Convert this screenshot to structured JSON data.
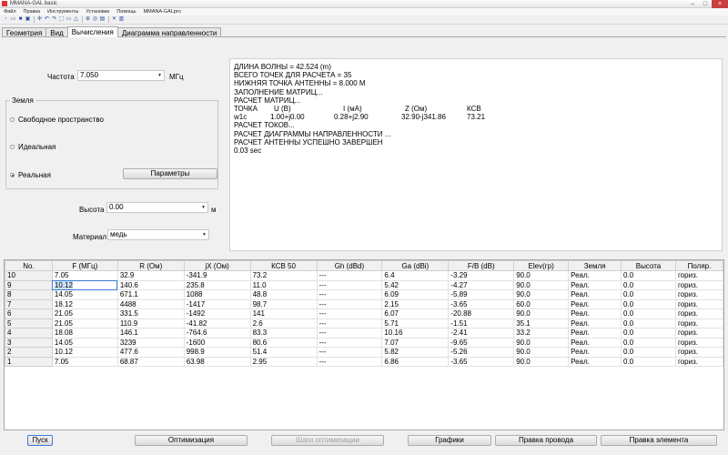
{
  "window": {
    "title": "MMANA-GAL basic"
  },
  "menu": [
    "Файл",
    "Правка",
    "Инструменты",
    "Установки",
    "Помощь",
    "MMANA-GALpro"
  ],
  "toolbar_icons": [
    "new-icon",
    "open-icon",
    "save-icon",
    "print-icon",
    "separator",
    "arrows-icon",
    "undo-icon",
    "redo-icon",
    "select-icon",
    "rect-icon",
    "copy-icon",
    "separator",
    "zoom-icon",
    "target-icon",
    "paste-icon",
    "separator",
    "tools-icon",
    "delete-icon"
  ],
  "tabs": [
    "Геометрия",
    "Вид",
    "Вычисления",
    "Диаграмма направленности"
  ],
  "active_tab": 2,
  "frequency": {
    "label": "Частота",
    "value": "7.050",
    "unit": "МГц"
  },
  "ground": {
    "title": "Земля",
    "options": [
      "Свободное пространство",
      "Идеальная",
      "Реальная"
    ],
    "selected": 2,
    "params_button": "Параметры"
  },
  "height": {
    "label": "Высота",
    "value": "0.00",
    "unit": "м"
  },
  "material": {
    "label": "Материал",
    "value": "медь"
  },
  "log": {
    "lines_top": [
      "ДЛИНА ВОЛНЫ = 42.524 (m)",
      "ВСЕГО ТОЧЕК ДЛЯ РАСЧЕТА = 35",
      "НИЖНЯЯ ТОЧКА АНТЕННЫ = 8.000 М",
      "ЗАПОЛНЕНИЕ МАТРИЦ...",
      "РАСЧЕТ МАТРИЦ..."
    ],
    "table_header": [
      "ТОЧКА",
      "U (В)",
      "I (мА)",
      "Z (Ом)",
      "КСВ"
    ],
    "table_row": [
      "w1c",
      "1.00+j0.00",
      "0.28+j2.90",
      "32.90-j341.86",
      "73.21"
    ],
    "lines_bottom": [
      "РАСЧЕТ ТОКОВ...",
      "РАСЧЕТ ДИАГРАММЫ НАПРАВЛЕННОСТИ ...",
      "РАСЧЕТ АНТЕННЫ УСПЕШНО ЗАВЕРШЕН",
      "0.03 sec"
    ]
  },
  "grid": {
    "columns": [
      "No.",
      "F (МГц)",
      "R (Ом)",
      "jX (Ом)",
      "КСВ 50",
      "Gh (dBd)",
      "Ga (dBi)",
      "F/B (dB)",
      "Elev(гр)",
      "Земля",
      "Высота",
      "Поляр."
    ],
    "rows": [
      [
        "10",
        "7.05",
        "32.9",
        "-341.9",
        "73.2",
        "---",
        "6.4",
        "-3.29",
        "90.0",
        "Реал.",
        "0.0",
        "гориз."
      ],
      [
        "9",
        "10.12",
        "140.6",
        "235.8",
        "11.0",
        "---",
        "5.42",
        "-4.27",
        "90.0",
        "Реал.",
        "0.0",
        "гориз."
      ],
      [
        "8",
        "14.05",
        "671.1",
        "1088",
        "48.8",
        "---",
        "6.09",
        "-5.89",
        "90.0",
        "Реал.",
        "0.0",
        "гориз."
      ],
      [
        "7",
        "18.12",
        "4488",
        "-1417",
        "98.7",
        "---",
        "2.15",
        "-3.65",
        "60.0",
        "Реал.",
        "0.0",
        "гориз."
      ],
      [
        "6",
        "21.05",
        "331.5",
        "-1492",
        "141",
        "---",
        "6.07",
        "-20.88",
        "90.0",
        "Реал.",
        "0.0",
        "гориз."
      ],
      [
        "5",
        "21.05",
        "110.9",
        "-41.82",
        "2.6",
        "---",
        "5.71",
        "-1.51",
        "35.1",
        "Реал.",
        "0.0",
        "гориз."
      ],
      [
        "4",
        "18.08",
        "146.1",
        "-764.6",
        "83.3",
        "---",
        "10.16",
        "-2.41",
        "33.2",
        "Реал.",
        "0.0",
        "гориз."
      ],
      [
        "3",
        "14.05",
        "3239",
        "-1600",
        "80.6",
        "---",
        "7.07",
        "-9.65",
        "90.0",
        "Реал.",
        "0.0",
        "гориз."
      ],
      [
        "2",
        "10.12",
        "477.6",
        "998.9",
        "51.4",
        "---",
        "5.82",
        "-5.26",
        "90.0",
        "Реал.",
        "0.0",
        "гориз."
      ],
      [
        "1",
        "7.05",
        "68.87",
        "63.98",
        "2.95",
        "---",
        "6.86",
        "-3.65",
        "90.0",
        "Реал.",
        "0.0",
        "гориз."
      ]
    ],
    "selected_row": 1,
    "selected_col": 1
  },
  "buttons": {
    "start": "Пуск",
    "optimize": "Оптимизация",
    "opt_steps": "Шаги оптимизации",
    "graphs": "Графики",
    "edit_wire": "Правка провода",
    "edit_element": "Правка элемента"
  }
}
